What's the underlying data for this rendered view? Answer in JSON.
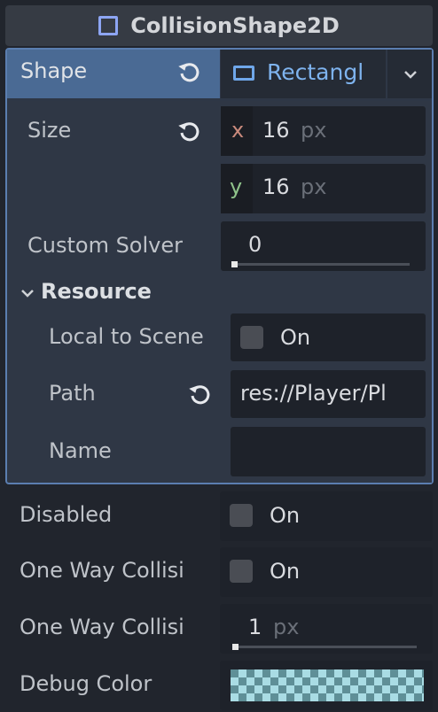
{
  "title": "CollisionShape2D",
  "shape": {
    "label": "Shape",
    "value": "Rectangl"
  },
  "size": {
    "label": "Size",
    "x_axis": "x",
    "x_value": "16",
    "y_axis": "y",
    "y_value": "16",
    "unit": "px"
  },
  "custom_solver": {
    "label": "Custom Solver",
    "value": "0"
  },
  "resource": {
    "label": "Resource",
    "local_to_scene_label": "Local to Scene",
    "local_to_scene_value": "On",
    "path_label": "Path",
    "path_value": "res://Player/Pl",
    "name_label": "Name",
    "name_value": ""
  },
  "disabled": {
    "label": "Disabled",
    "value": "On"
  },
  "one_way_collision": {
    "label": "One Way Collisi",
    "value": "On"
  },
  "one_way_margin": {
    "label": "One Way Collisi",
    "value": "1",
    "unit": "px"
  },
  "debug_color": {
    "label": "Debug Color",
    "color_a": "#a9dce4",
    "color_b": "#5f8f97"
  }
}
